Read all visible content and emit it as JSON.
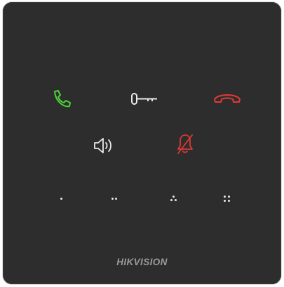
{
  "device": {
    "brand": "HIKVISION",
    "colors": {
      "panel": "#2d2d2d",
      "call": "#4cd137",
      "hangup": "#e03a36",
      "neutral": "#e8e8e8",
      "mute": "#d83a34",
      "brand_text": "#9a9a9a"
    }
  },
  "buttons": {
    "call": {
      "icon": "phone-answer-icon"
    },
    "unlock": {
      "icon": "key-icon"
    },
    "hangup": {
      "icon": "phone-hangup-icon"
    },
    "volume": {
      "icon": "speaker-volume-icon"
    },
    "mute": {
      "icon": "bell-off-icon"
    },
    "function_keys": [
      {
        "icon": "one-dot-icon",
        "dots": 1
      },
      {
        "icon": "two-dots-icon",
        "dots": 2
      },
      {
        "icon": "three-dots-icon",
        "dots": 3
      },
      {
        "icon": "four-dots-icon",
        "dots": 4
      }
    ]
  }
}
